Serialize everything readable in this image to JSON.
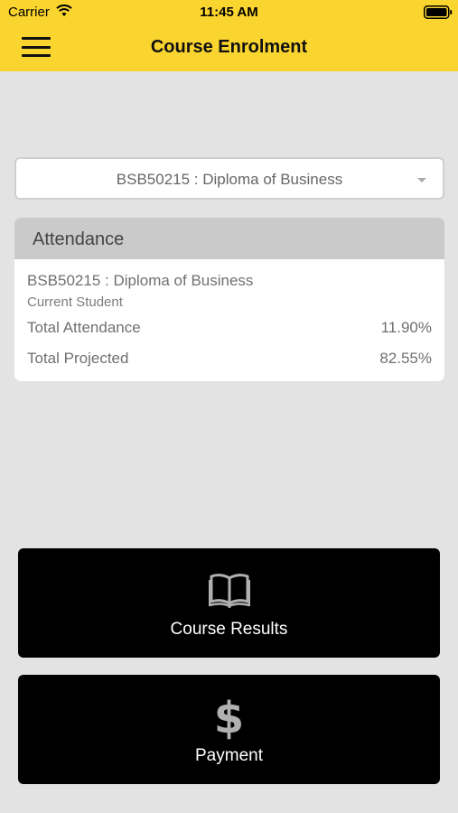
{
  "status_bar": {
    "carrier": "Carrier",
    "time": "11:45 AM"
  },
  "header": {
    "title": "Course Enrolment",
    "background_color": "#fad42f"
  },
  "course_select": {
    "value": "BSB50215 : Diploma of Business"
  },
  "attendance_card": {
    "title": "Attendance",
    "course_name": "BSB50215 : Diploma of Business",
    "student_status": "Current Student",
    "rows": [
      {
        "label": "Total Attendance",
        "value": "11.90%"
      },
      {
        "label": "Total Projected",
        "value": "82.55%"
      }
    ]
  },
  "actions": {
    "course_results": {
      "label": "Course Results",
      "icon": "book-icon"
    },
    "payment": {
      "label": "Payment",
      "icon": "dollar-icon",
      "glyph": "$"
    }
  }
}
